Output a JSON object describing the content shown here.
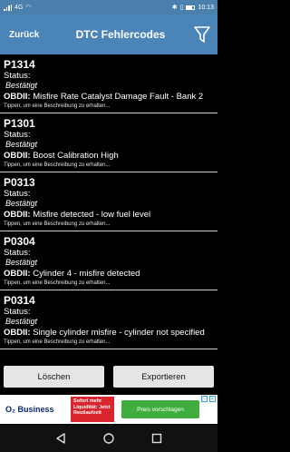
{
  "status_bar": {
    "time": "10:13",
    "network": "4G"
  },
  "app_bar": {
    "back_label": "Zurück",
    "title": "DTC Fehlercodes"
  },
  "dtcs": [
    {
      "code": "P1314",
      "status_label": "Status:",
      "status": "Bestätigt",
      "prefix": "OBDII:",
      "description": "Misfire Rate Catalyst Damage Fault - Bank 2",
      "hint": "Tippen, um eine Beschreibung zu erhalten..."
    },
    {
      "code": "P1301",
      "status_label": "Status:",
      "status": "Bestätigt",
      "prefix": "OBDII:",
      "description": "Boost Calibration High",
      "hint": "Tippen, um eine Beschreibung zu erhalten..."
    },
    {
      "code": "P0313",
      "status_label": "Status:",
      "status": "Bestätigt",
      "prefix": "OBDII:",
      "description": "Misfire detected - low fuel level",
      "hint": "Tippen, um eine Beschreibung zu erhalten..."
    },
    {
      "code": "P0304",
      "status_label": "Status:",
      "status": "Bestätigt",
      "prefix": "OBDII:",
      "description": "Cylinder 4 - misfire detected",
      "hint": "Tippen, um eine Beschreibung zu erhalten..."
    },
    {
      "code": "P0314",
      "status_label": "Status:",
      "status": "Bestätigt",
      "prefix": "OBDII:",
      "description": "Single cylinder misfire - cylinder not specified",
      "hint": "Tippen, um eine Beschreibung zu erhalten..."
    }
  ],
  "actions": {
    "delete_label": "Löschen",
    "export_label": "Exportieren"
  },
  "ad": {
    "brand": "O₂ Business",
    "offer": "Sofort mehr Liquidität: Jetzt Restlaufzeit",
    "cta": "Preis vorschlagen"
  },
  "icons": {
    "filter": "filter-icon",
    "back": "back-triangle-icon",
    "home": "home-circle-icon",
    "recents": "recents-square-icon"
  },
  "colors": {
    "app_bar": "#4b84b6",
    "status_bar": "#4a7fae",
    "background": "#000000",
    "button": "#e5e5e5",
    "divider": "#cfcfcf"
  }
}
